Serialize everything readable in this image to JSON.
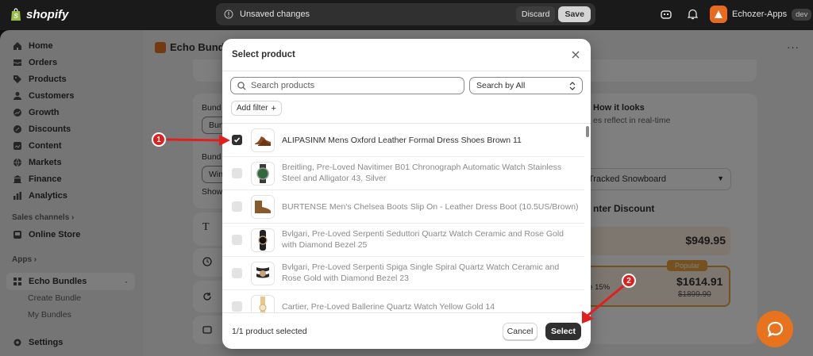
{
  "topbar": {
    "logo_text": "shopify",
    "unsaved_text": "Unsaved changes",
    "discard_label": "Discard",
    "save_label": "Save",
    "store_name": "Echozer-Apps",
    "env_badge": "dev"
  },
  "sidebar": {
    "items": [
      {
        "label": "Home",
        "icon": "home-icon"
      },
      {
        "label": "Orders",
        "icon": "orders-icon"
      },
      {
        "label": "Products",
        "icon": "tag-icon"
      },
      {
        "label": "Customers",
        "icon": "person-icon"
      },
      {
        "label": "Growth",
        "icon": "growth-icon"
      },
      {
        "label": "Discounts",
        "icon": "discount-icon"
      },
      {
        "label": "Content",
        "icon": "content-icon"
      },
      {
        "label": "Markets",
        "icon": "globe-icon"
      },
      {
        "label": "Finance",
        "icon": "bank-icon"
      },
      {
        "label": "Analytics",
        "icon": "chart-icon"
      }
    ],
    "sales_channels_label": "Sales channels",
    "online_store_label": "Online Store",
    "apps_label": "Apps",
    "app_name": "Echo Bundles",
    "app_subitems": [
      "Create Bundle",
      "My Bundles"
    ],
    "settings_label": "Settings"
  },
  "background": {
    "page_title": "Echo Bundle",
    "field_label_1": "Bund",
    "field_value_1": "Bun",
    "field_label_2": "Bund",
    "field_value_2": "Win",
    "show_text": "Show",
    "preview_title": "How it looks",
    "preview_sub": "es reflect in real-time",
    "product_select": "Tracked Snowboard",
    "discount_title": "nter Discount",
    "price_1": "$949.95",
    "popular_badge": "Popular",
    "save_pct": "re 15%",
    "price_2": "$1614.91",
    "price_2_old": "$1899.90"
  },
  "modal": {
    "title": "Select product",
    "search_placeholder": "Search products",
    "search_by_label": "Search by All",
    "add_filter_label": "Add filter",
    "products": [
      {
        "name": "ALIPASINM Mens Oxford Leather Formal Dress Shoes Brown 11",
        "selected": true,
        "thumb": "shoe-icon"
      },
      {
        "name": "Breitling, Pre-Loved Navitimer B01 Chronograph Automatic Watch Stainless Steel and Alligator 43, Silver",
        "selected": false,
        "thumb": "watch-icon"
      },
      {
        "name": "BURTENSE Men's Chelsea Boots Slip On - Leather Dress Boot   (10.5US/Brown)",
        "selected": false,
        "thumb": "boot-icon"
      },
      {
        "name": "Bvlgari, Pre-Loved Serpenti Seduttori Quartz Watch Ceramic and Rose Gold with Diamond Bezel 25",
        "selected": false,
        "thumb": "watch-icon"
      },
      {
        "name": "Bvlgari, Pre-Loved Serpenti Spiga Single Spiral Quartz Watch Ceramic and Rose Gold with Diamond Bezel 23",
        "selected": false,
        "thumb": "watch-icon"
      },
      {
        "name": "Cartier, Pre-Loved Ballerine Quartz Watch Yellow Gold 14",
        "selected": false,
        "thumb": "watch-icon"
      }
    ],
    "selection_count": "1/1 product selected",
    "cancel_label": "Cancel",
    "select_label": "Select"
  },
  "annotations": {
    "step_1": "1",
    "step_2": "2"
  },
  "colors": {
    "accent_orange": "#e8731f",
    "annotation_red": "#e02020",
    "primary_dark": "#303030"
  }
}
